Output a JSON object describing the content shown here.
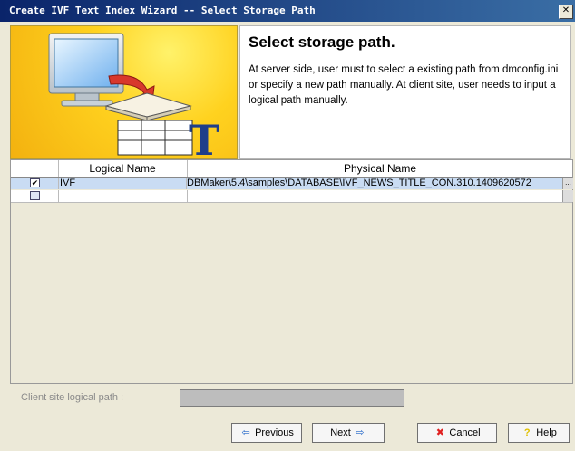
{
  "window": {
    "title": "Create IVF Text Index Wizard -- Select Storage Path",
    "close_glyph": "✕"
  },
  "banner": {
    "title": "Select storage path.",
    "description": "At server side, user must to select a existing path from dmconfig.ini or specify a new path manually. At client site, user needs to input a logical path manually.",
    "logo_letter": "T"
  },
  "table": {
    "columns": [
      "",
      "Logical Name",
      "Physical Name"
    ],
    "rows": [
      {
        "checked": true,
        "check_glyph": "✔",
        "logical": "IVF",
        "physical": "DBMaker\\5.4\\samples\\DATABASE\\IVF_NEWS_TITLE_CON.310.1409620572",
        "ellipsis": "..."
      },
      {
        "checked": false,
        "check_glyph": "",
        "logical": "",
        "physical": "",
        "ellipsis": "..."
      }
    ]
  },
  "client": {
    "label": "Client site logical path :",
    "value": ""
  },
  "buttons": {
    "previous": {
      "label": "Previous",
      "icon": "left-arrow-icon",
      "glyph": "⇦"
    },
    "next": {
      "label": "Next",
      "icon": "right-arrow-icon",
      "glyph": "⇨"
    },
    "cancel": {
      "label": "Cancel",
      "icon": "x-icon",
      "glyph": "✖",
      "color": "#e02020"
    },
    "help": {
      "label": "Help",
      "icon": "question-icon",
      "glyph": "?",
      "color": "#e0c000"
    }
  }
}
